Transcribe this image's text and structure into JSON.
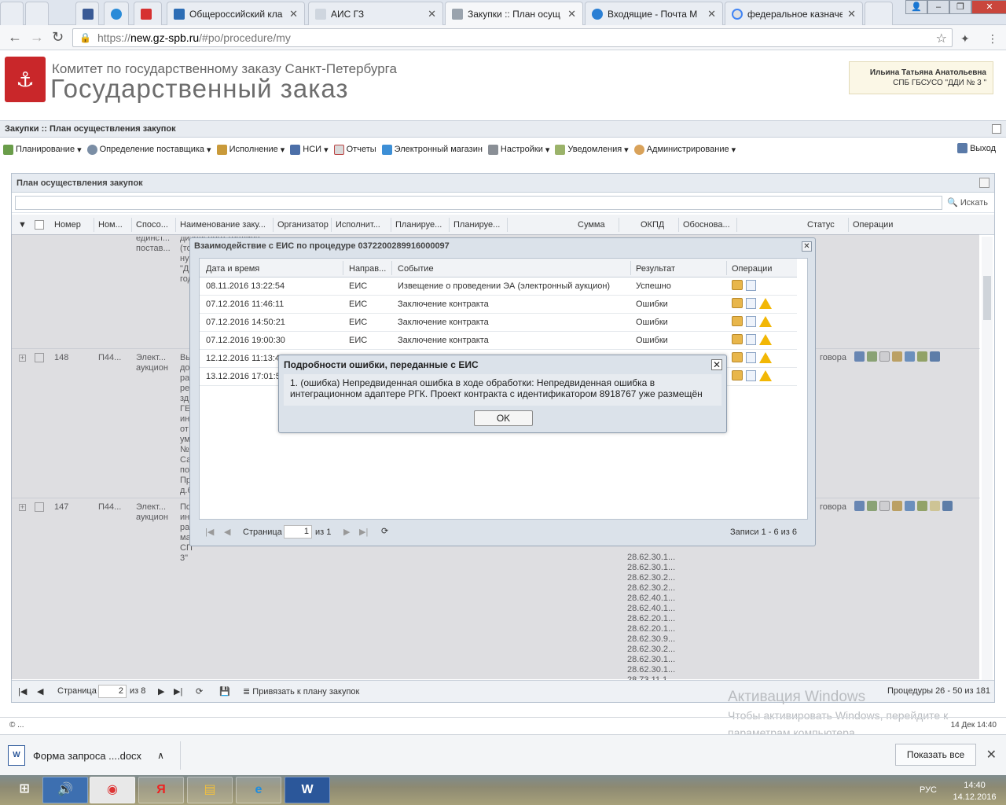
{
  "browser": {
    "tabs": [
      {
        "title": "Общероссийский кла",
        "active": false
      },
      {
        "title": "АИС ГЗ",
        "active": false
      },
      {
        "title": "Закупки :: План осущ",
        "active": true
      },
      {
        "title": "Входящие - Почта М",
        "active": false
      },
      {
        "title": "федеральное казначе",
        "active": false
      }
    ],
    "url_scheme": "https://",
    "url_host": "new.gz-spb.ru",
    "url_path": "/#po/procedure/my"
  },
  "header": {
    "org_line1": "Комитет по государственному заказу Санкт-Петербурга",
    "org_line2": "Государственный заказ",
    "user_name": "Ильина Татьяна Анатольевна",
    "user_org": "СПБ ГБСУСО \"ДДИ № 3 \""
  },
  "page_title": "Закупки :: План осуществления закупок",
  "menu": {
    "items": [
      "Планирование",
      "Определение поставщика",
      "Исполнение",
      "НСИ",
      "Отчеты",
      "Электронный магазин",
      "Настройки",
      "Уведомления",
      "Администрирование"
    ],
    "exit": "Выход"
  },
  "panel": {
    "title": "План осуществления закупок",
    "search_button": "Искать",
    "columns": [
      "Номер",
      "Ном...",
      "Спосо...",
      "Наименование заку...",
      "Организатор",
      "Исполнит...",
      "Планируе...",
      "Планируе...",
      "Сумма",
      "ОКПД",
      "Обоснова...",
      "Статус",
      "Операции"
    ],
    "rows": [
      {
        "number": "",
        "num2": "",
        "method": "единст...\nпостав...",
        "name": "дизельного топлива\n(то\nну\n\"Д\nгод",
        "okpd": "",
        "status": ""
      },
      {
        "number": "148",
        "num2": "П44...",
        "method": "Элект...\nаукцион",
        "name": "Вы\nдо\nра\nре\nзд\nГЕ\nин\nот\nум\n№\nСа\nпо\nПр\nд.6",
        "status": "говора"
      },
      {
        "number": "147",
        "num2": "П44...",
        "method": "Элект...\nаукцион",
        "name": "По\nин\nра\nма\nСП\n3\"",
        "status": "говора"
      }
    ],
    "okpd_codes": [
      "28.62.30.1...",
      "28.62.30.1...",
      "28.62.30.2...",
      "28.62.30.2...",
      "28.62.40.1...",
      "28.62.40.1...",
      "28.62.20.1...",
      "28.62.20.1...",
      "28.62.30.9...",
      "28.62.30.2...",
      "28.62.30.1...",
      "28.62.30.1...",
      "28.73.11.1"
    ],
    "footer": {
      "page_label": "Страница",
      "page_value": "2",
      "page_of": "из 8",
      "attach": "Привязать к плану закупок",
      "summary": "Процедуры 26 - 50 из 181"
    }
  },
  "eis_window": {
    "title": "Взаимодействие с ЕИС по процедуре 0372200289916000097",
    "columns": [
      "Дата и время",
      "Направ...",
      "Событие",
      "Результат",
      "Операции"
    ],
    "rows": [
      {
        "datetime": "08.11.2016 13:22:54",
        "direction": "ЕИС",
        "event": "Извещение о проведении ЭА (электронный аукцион)",
        "result": "Успешно",
        "warn": false
      },
      {
        "datetime": "07.12.2016 11:46:11",
        "direction": "ЕИС",
        "event": "Заключение контракта",
        "result": "Ошибки",
        "warn": true
      },
      {
        "datetime": "07.12.2016 14:50:21",
        "direction": "ЕИС",
        "event": "Заключение контракта",
        "result": "Ошибки",
        "warn": true
      },
      {
        "datetime": "07.12.2016 19:00:30",
        "direction": "ЕИС",
        "event": "Заключение контракта",
        "result": "Ошибки",
        "warn": true
      },
      {
        "datetime": "12.12.2016 11:13:4",
        "direction": "",
        "event": "",
        "result": "",
        "warn": true
      },
      {
        "datetime": "13.12.2016 17:01:5",
        "direction": "",
        "event": "",
        "result": "",
        "warn": true
      }
    ],
    "footer": {
      "page_label": "Страница",
      "page_value": "1",
      "page_of": "из 1",
      "records": "Записи 1 - 6 из 6"
    }
  },
  "error_dialog": {
    "title": "Подробности ошибки, переданные с ЕИС",
    "message": "1. (ошибка) Непредвиденная ошибка в ходе обработки: Непредвиденная ошибка в интеграционном адаптере РГК. Проект контракта с идентификатором 8918767 уже размещён",
    "ok": "OK"
  },
  "status": {
    "left": "© ...",
    "right": "14 Дек 14:40"
  },
  "watermark": {
    "line1": "Активация Windows",
    "line2": "Чтобы активировать Windows, перейдите к",
    "line3": "параметрам компьютера."
  },
  "downloads": {
    "file": "Форма запроса ....docx",
    "show_all": "Показать все"
  },
  "taskbar": {
    "lang": "РУС",
    "time": "14:40",
    "date": "14.12.2016"
  }
}
